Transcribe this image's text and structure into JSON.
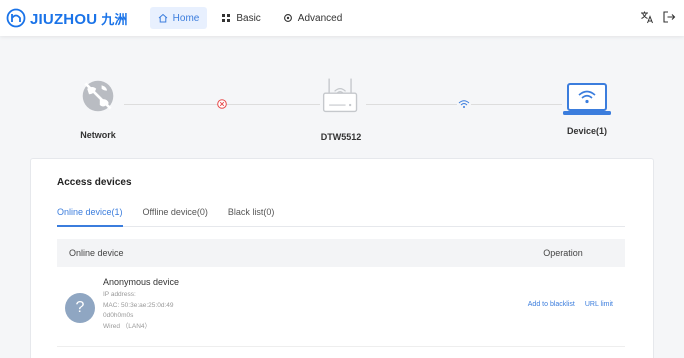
{
  "brand": {
    "name": "JIUZHOU",
    "name_cn": "九洲",
    "color": "#1a73e8"
  },
  "nav": [
    {
      "label": "Home",
      "icon": "home-icon",
      "active": true
    },
    {
      "label": "Basic",
      "icon": "grid-icon",
      "active": false
    },
    {
      "label": "Advanced",
      "icon": "gear-icon",
      "active": false
    }
  ],
  "header_right": {
    "language_icon": "translate-icon",
    "logout_icon": "logout-icon"
  },
  "topology": {
    "network": {
      "label": "Network",
      "icon": "globe-icon",
      "status": "disconnected",
      "status_icon": "error-x-icon",
      "status_color": "#e84a4a"
    },
    "router": {
      "label": "DTW5512",
      "icon": "router-icon"
    },
    "wifi_link_icon": "wifi-icon",
    "device": {
      "label": "Device(1)",
      "icon": "laptop-wifi-icon"
    },
    "accent": "#3b7ddd"
  },
  "access": {
    "title": "Access devices",
    "tabs": [
      {
        "label": "Online device(1)",
        "active": true
      },
      {
        "label": "Offline device(0)",
        "active": false
      },
      {
        "label": "Black list(0)",
        "active": false
      }
    ],
    "table": {
      "col_device": "Online device",
      "col_operation": "Operation",
      "rows": [
        {
          "avatar": "?",
          "name": "Anonymous device",
          "ip": "IP address:",
          "mac": "MAC: 50:3e:ae:25:0d:49",
          "uptime": "0d0h0m0s",
          "connection": "Wired （LAN4）",
          "actions": [
            "Add to blacklist",
            "URL limit"
          ]
        }
      ]
    }
  }
}
